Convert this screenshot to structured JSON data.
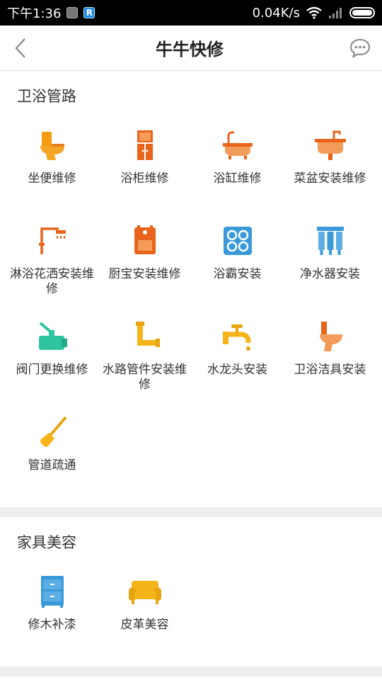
{
  "status_bar": {
    "time": "下午1:36",
    "network_speed": "0.04K/s"
  },
  "header": {
    "title": "牛牛快修"
  },
  "sections": [
    {
      "title": "卫浴管路",
      "items": [
        {
          "label": "坐便维修",
          "icon": "toilet-icon"
        },
        {
          "label": "浴柜维修",
          "icon": "cabinet-icon"
        },
        {
          "label": "浴缸维修",
          "icon": "bathtub-icon"
        },
        {
          "label": "菜盆安装维修",
          "icon": "sink-icon"
        },
        {
          "label": "淋浴花洒安装维修",
          "icon": "shower-icon"
        },
        {
          "label": "厨宝安装维修",
          "icon": "water-heater-icon"
        },
        {
          "label": "浴霸安装",
          "icon": "bath-heater-icon"
        },
        {
          "label": "净水器安装",
          "icon": "water-purifier-icon"
        },
        {
          "label": "阀门更换维修",
          "icon": "valve-icon"
        },
        {
          "label": "水路管件安装维修",
          "icon": "pipe-icon"
        },
        {
          "label": "水龙头安装",
          "icon": "faucet-icon"
        },
        {
          "label": "卫浴洁具安装",
          "icon": "sanitary-ware-icon"
        },
        {
          "label": "管道疏通",
          "icon": "plunger-icon"
        }
      ]
    },
    {
      "title": "家具美容",
      "items": [
        {
          "label": "修木补漆",
          "icon": "wood-cabinet-icon"
        },
        {
          "label": "皮革美容",
          "icon": "sofa-icon"
        }
      ]
    }
  ]
}
